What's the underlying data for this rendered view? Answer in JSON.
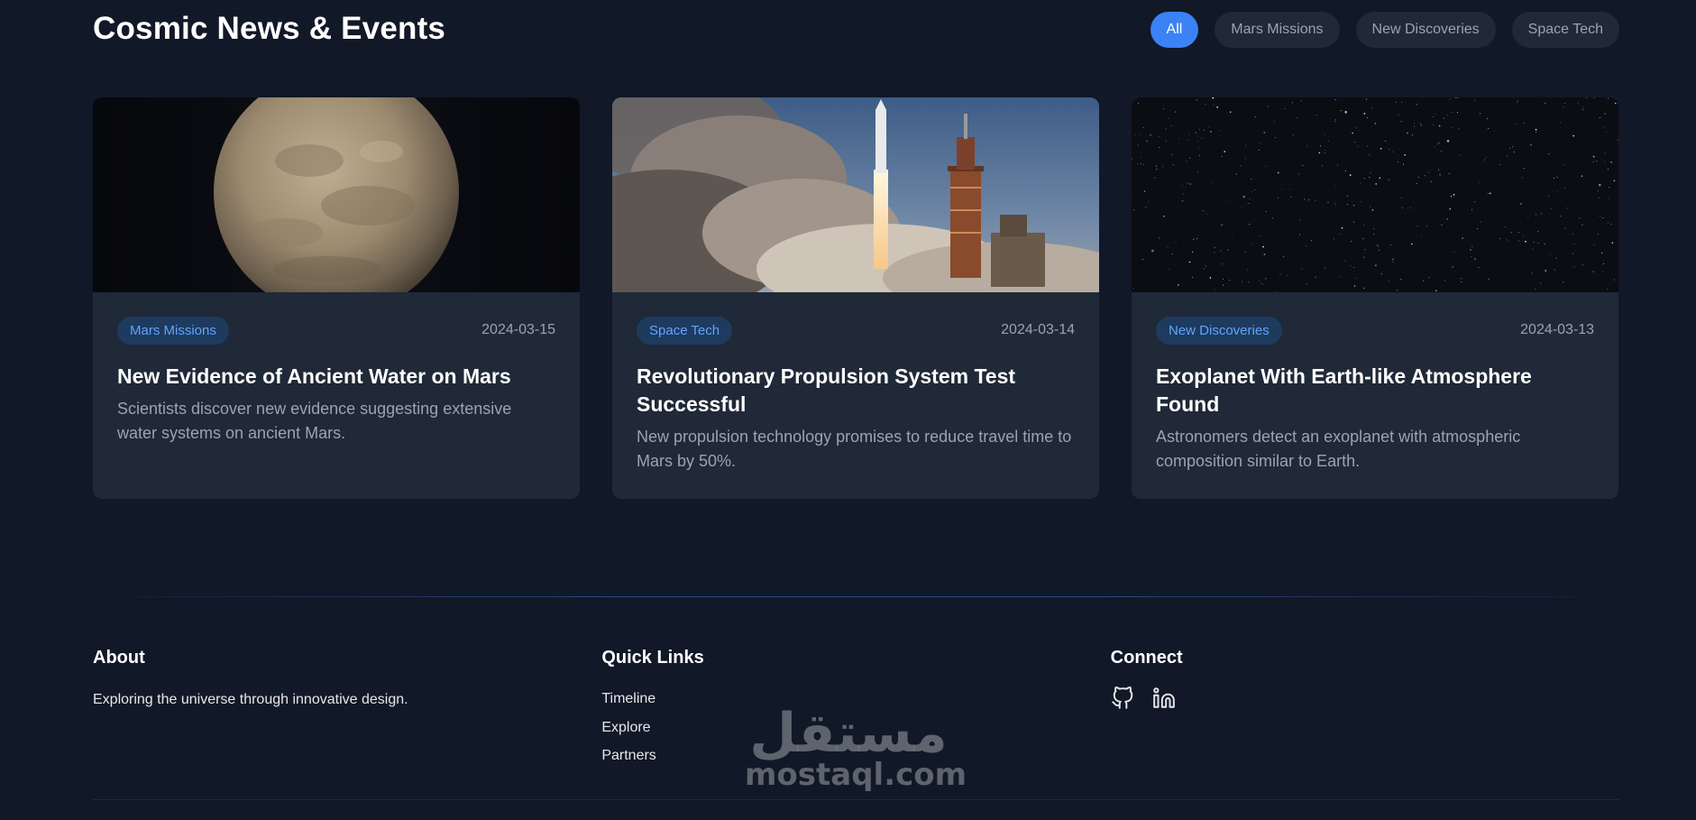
{
  "header": {
    "title": "Cosmic News & Events",
    "filters": [
      {
        "label": "All",
        "active": true
      },
      {
        "label": "Mars Missions",
        "active": false
      },
      {
        "label": "New Discoveries",
        "active": false
      },
      {
        "label": "Space Tech",
        "active": false
      }
    ]
  },
  "cards": [
    {
      "image": "mars-planet-image",
      "tag": "Mars Missions",
      "date": "2024-03-15",
      "title": "New Evidence of Ancient Water on Mars",
      "description": "Scientists discover new evidence suggesting extensive water systems on ancient Mars."
    },
    {
      "image": "rocket-launch-image",
      "tag": "Space Tech",
      "date": "2024-03-14",
      "title": "Revolutionary Propulsion System Test Successful",
      "description": "New propulsion technology promises to reduce travel time to Mars by 50%."
    },
    {
      "image": "starfield-image",
      "tag": "New Discoveries",
      "date": "2024-03-13",
      "title": "Exoplanet With Earth-like Atmosphere Found",
      "description": "Astronomers detect an exoplanet with atmospheric composition similar to Earth."
    }
  ],
  "footer": {
    "about": {
      "heading": "About",
      "text": "Exploring the universe through innovative design."
    },
    "quick_links": {
      "heading": "Quick Links",
      "items": [
        "Timeline",
        "Explore",
        "Partners"
      ]
    },
    "connect": {
      "heading": "Connect",
      "icons": [
        "github-icon",
        "linkedin-icon"
      ]
    }
  },
  "watermark": {
    "arabic": "مستقل",
    "latin": "mostaql.com"
  },
  "colors": {
    "background": "#111827",
    "card": "#1f2937",
    "accent": "#3b82f6",
    "tag_text": "#60a5fa",
    "muted_text": "#9ca3af"
  }
}
